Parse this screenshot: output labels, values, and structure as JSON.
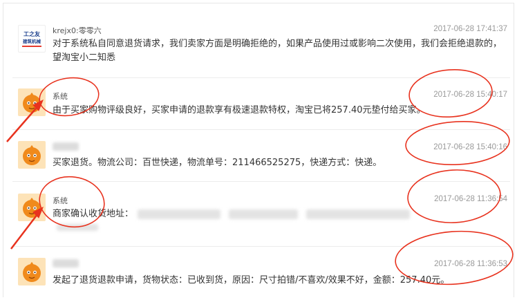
{
  "messages": [
    {
      "sender": "krejx0:零零六",
      "time": "2017-06-28 17:41:37",
      "text": "对于系统私自同意退货请求，我们卖家方面是明确拒绝的，如果产品使用过或影响二次使用，我们会拒绝退款的，望淘宝小二知悉",
      "logo_lines": [
        "工之友",
        "建筑机械"
      ]
    },
    {
      "sender": "系统",
      "time": "2017-06-28 15:40:17",
      "text": "由于买家购物评级良好，买家申请的退款享有极速退款特权，淘宝已将257.40元垫付给买家。"
    },
    {
      "sender": "",
      "time": "2017-06-28 15:40:16",
      "text": "买家退货。物流公司：百世快递，物流单号：211466525275，快递方式：快递。"
    },
    {
      "sender": "系统",
      "time": "2017-06-28 11:36:54",
      "text": "商家确认收货地址："
    },
    {
      "sender": "",
      "time": "2017-06-28 11:36:53",
      "text": "发起了退货退款申请，货物状态：已收到货，原因：尺寸拍错/不喜欢/效果不好，金额：257.40元。"
    }
  ],
  "colors": {
    "annotation_red": "#e8321e",
    "avatar_orange": "#f08a1c",
    "avatar_bg": "#fde3b8"
  }
}
